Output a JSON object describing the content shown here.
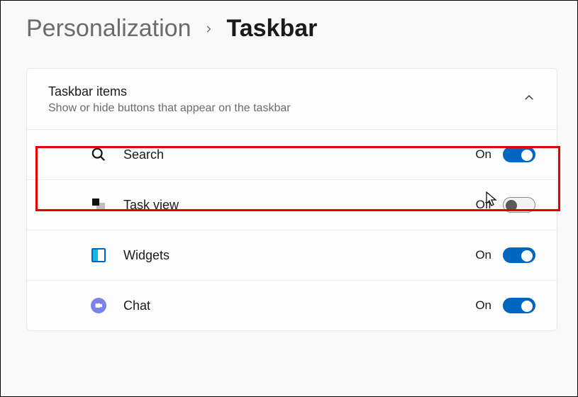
{
  "breadcrumb": {
    "parent": "Personalization",
    "current": "Taskbar"
  },
  "section": {
    "title": "Taskbar items",
    "subtitle": "Show or hide buttons that appear on the taskbar"
  },
  "items": [
    {
      "label": "Search",
      "state": "On",
      "on": true
    },
    {
      "label": "Task view",
      "state": "Off",
      "on": false
    },
    {
      "label": "Widgets",
      "state": "On",
      "on": true
    },
    {
      "label": "Chat",
      "state": "On",
      "on": true
    }
  ]
}
